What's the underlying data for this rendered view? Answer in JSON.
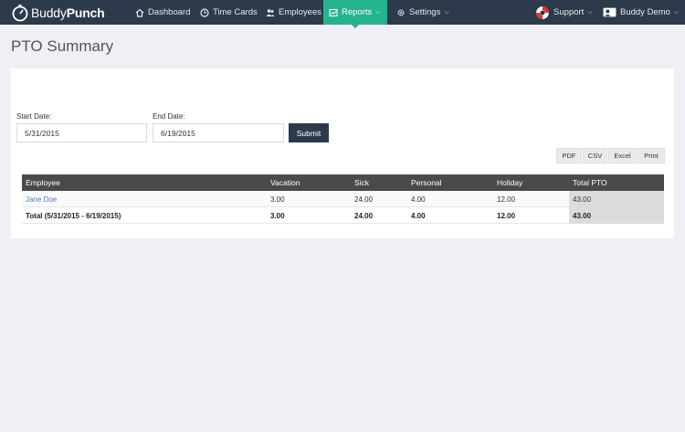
{
  "app": {
    "logo_part1": "Buddy",
    "logo_part2": "Punch"
  },
  "nav": {
    "dashboard": "Dashboard",
    "time_cards": "Time Cards",
    "employees": "Employees",
    "reports": "Reports",
    "settings": "Settings",
    "support": "Support",
    "user": "Buddy Demo"
  },
  "page": {
    "title": "PTO Summary"
  },
  "filters": {
    "start_label": "Start Date:",
    "start_value": "5/31/2015",
    "end_label": "End Date:",
    "end_value": "6/19/2015",
    "submit": "Submit"
  },
  "export": {
    "pdf": "PDF",
    "csv": "CSV",
    "excel": "Excel",
    "print": "Print"
  },
  "table": {
    "headers": [
      "Employee",
      "Vacation",
      "Sick",
      "Personal",
      "Holiday",
      "Total PTO"
    ],
    "rows": [
      [
        "Jane Doe",
        "3.00",
        "24.00",
        "4.00",
        "12.00",
        "43.00"
      ]
    ],
    "total": [
      "Total (5/31/2015 - 6/19/2015)",
      "3.00",
      "24.00",
      "4.00",
      "12.00",
      "43.00"
    ]
  },
  "colors": {
    "navbar": "#2d3a4b",
    "accent": "#24b38d",
    "link": "#4a7fb5"
  }
}
